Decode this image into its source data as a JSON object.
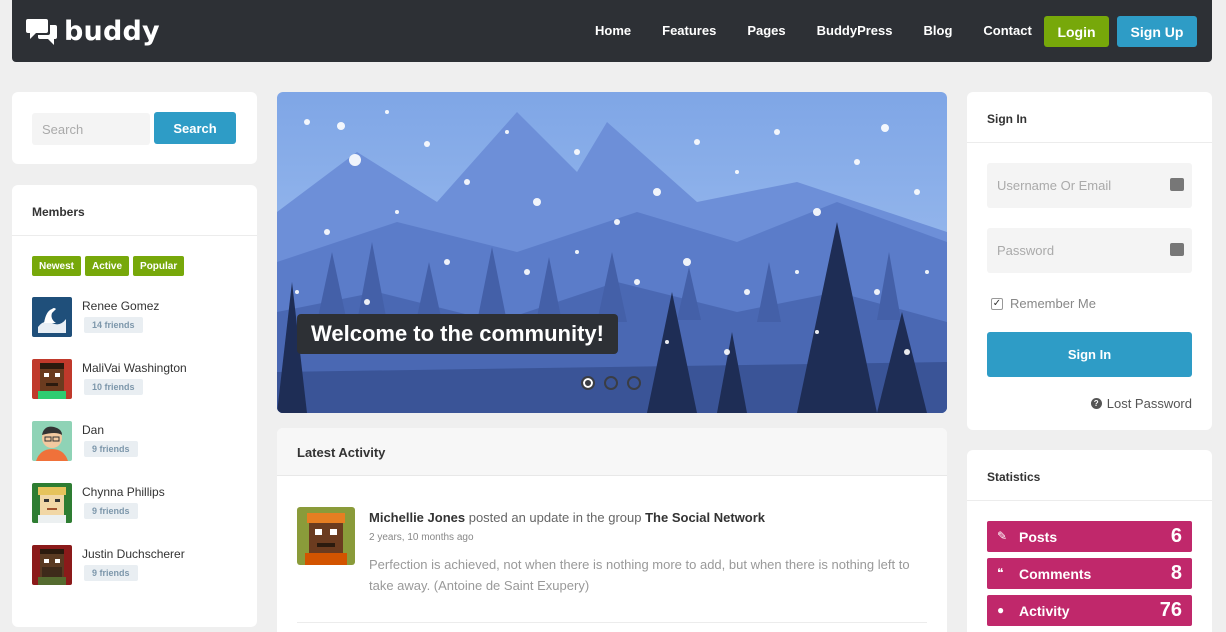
{
  "header": {
    "logo": "buddy",
    "nav": [
      "Home",
      "Features",
      "Pages",
      "BuddyPress",
      "Blog",
      "Contact"
    ],
    "login_label": "Login",
    "signup_label": "Sign Up"
  },
  "search": {
    "placeholder": "Search",
    "button_label": "Search"
  },
  "members": {
    "title": "Members",
    "tabs": [
      "Newest",
      "Active",
      "Popular"
    ],
    "list": [
      {
        "name": "Renee Gomez",
        "friends": "14 friends"
      },
      {
        "name": "MaliVai Washington",
        "friends": "10 friends"
      },
      {
        "name": "Dan",
        "friends": "9 friends"
      },
      {
        "name": "Chynna Phillips",
        "friends": "9 friends"
      },
      {
        "name": "Justin Duchscherer",
        "friends": "9 friends"
      }
    ]
  },
  "hero": {
    "caption": "Welcome to the community!",
    "slides": 3,
    "active_slide": 1
  },
  "activity": {
    "title": "Latest Activity",
    "item": {
      "user": "Michellie Jones",
      "action": "posted an update in the group",
      "group": "The Social Network",
      "time": "2 years, 10 months ago",
      "text": "Perfection is achieved, not when there is nothing more to add, but when there is nothing left to take away. (Antoine de Saint Exupery)"
    }
  },
  "signin": {
    "title": "Sign In",
    "username_placeholder": "Username Or Email",
    "password_placeholder": "Password",
    "remember_label": "Remember Me",
    "button_label": "Sign In",
    "lost_label": "Lost Password"
  },
  "statistics": {
    "title": "Statistics",
    "items": [
      {
        "label": "Posts",
        "value": "6",
        "icon": "pencil-icon"
      },
      {
        "label": "Comments",
        "value": "8",
        "icon": "comments-icon"
      },
      {
        "label": "Activity",
        "value": "76",
        "icon": "activity-icon"
      }
    ]
  },
  "colors": {
    "header": "#2d3035",
    "green": "#77a80a",
    "blue": "#2e9cc6",
    "magenta": "#c0286b"
  }
}
